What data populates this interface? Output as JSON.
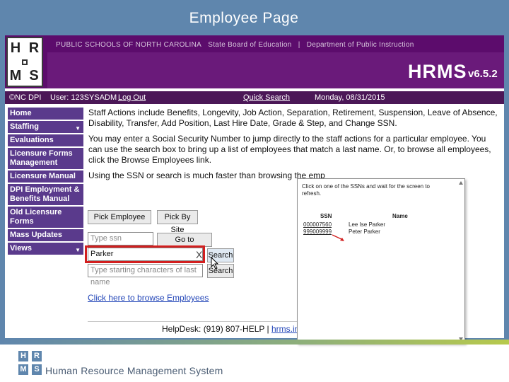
{
  "slide": {
    "title": "Employee Page",
    "footer_text": "Human Resource Management System",
    "footer_logo": [
      "H",
      "R",
      "M",
      "S"
    ]
  },
  "banner": {
    "logo": [
      "H",
      "R",
      "M",
      "S"
    ],
    "links": [
      "PUBLIC SCHOOLS OF NORTH CAROLINA",
      "State Board of Education",
      "|",
      "Department of Public Instruction"
    ],
    "app_name": "HRMS",
    "version": "v6.5.2"
  },
  "statusbar": {
    "copyright": "©NC DPI",
    "user": "User: 123SYSADM",
    "logout": "Log Out",
    "quick_search": "Quick Search",
    "date": "Monday, 08/31/2015"
  },
  "nav": {
    "items": [
      {
        "label": "Home",
        "caret": ""
      },
      {
        "label": "Staffing",
        "caret": "▼"
      },
      {
        "label": "Evaluations",
        "caret": ""
      },
      {
        "label": "Licensure Forms Management",
        "caret": ""
      },
      {
        "label": "Licensure Manual",
        "caret": ""
      },
      {
        "label": "DPI Employment & Benefits Manual",
        "caret": ""
      },
      {
        "label": "Old Licensure Forms",
        "caret": ""
      },
      {
        "label": "Mass Updates",
        "caret": ""
      },
      {
        "label": "Views",
        "caret": "▼"
      }
    ]
  },
  "content": {
    "para1": "Staff Actions include Benefits, Longevity, Job Action, Separation, Retirement, Suspension, Leave of Absence, Disability, Transfer, Add Position, Last Hire Date, Grade & Step, and Change SSN.",
    "para2": "You may enter a Social Security Number to jump directly to the staff actions for a particular employee. You can use the search box to bring up a list of employees that match a last name. Or, to browse all employees, click the Browse Employees link.",
    "para3": "Using the SSN or search is much faster than browsing the emp"
  },
  "controls": {
    "pick_employee": "Pick Employee",
    "pick_by_site": "Pick By Site",
    "ssn_placeholder": "Type ssn",
    "go_to_employee": "Go to employee",
    "search_value": "Parker",
    "clear_glyph": "X",
    "search_button": "Search",
    "lastname_placeholder": "Type starting characters of last name",
    "search_button_2": "Search",
    "browse_link": "Click here to browse Employees"
  },
  "helpdesk": {
    "text": "HelpDesk: (919) 807-HELP |",
    "link": "hrms.incide"
  },
  "popup": {
    "message": "Click on one of the SSNs and wait for the screen to refresh.",
    "col_ssn": "SSN",
    "col_name": "Name",
    "rows": [
      {
        "ssn": "000007560",
        "name": "Lee Ise Parker"
      },
      {
        "ssn": "999009999",
        "name": "Peter Parker"
      }
    ]
  },
  "colors": {
    "slide_blue": "#5f86ad",
    "banner_purple": "#5c0c6c",
    "nav_purple": "#5a3a8c",
    "highlight_red": "#d21f1f",
    "link_blue": "#2346b8"
  }
}
